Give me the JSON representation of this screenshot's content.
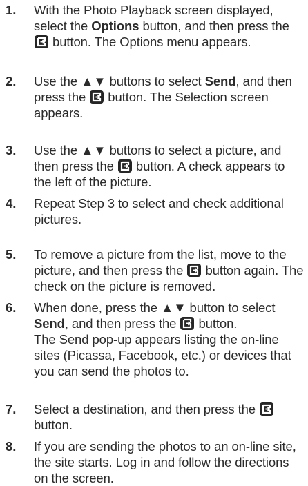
{
  "steps": [
    {
      "number": "1.",
      "segments": [
        {
          "t": "text",
          "v": "With the Photo Playback screen displayed, select the "
        },
        {
          "t": "bold",
          "v": "Options"
        },
        {
          "t": "text",
          "v": " button, and then press the "
        },
        {
          "t": "icon",
          "name": "enter-button-icon"
        },
        {
          "t": "text",
          "v": " button. The Options menu appears."
        }
      ]
    },
    {
      "number": "2.",
      "segments": [
        {
          "t": "text",
          "v": "Use the ▲▼ buttons to select "
        },
        {
          "t": "bold",
          "v": "Send"
        },
        {
          "t": "text",
          "v": ", and then press the "
        },
        {
          "t": "icon",
          "name": "enter-button-icon"
        },
        {
          "t": "text",
          "v": " button. The Selection screen appears."
        }
      ]
    },
    {
      "number": "3.",
      "segments": [
        {
          "t": "text",
          "v": "Use the ▲▼ buttons to select a picture, and then press the "
        },
        {
          "t": "icon",
          "name": "enter-button-icon"
        },
        {
          "t": "text",
          "v": " button. A check appears to the left of the picture."
        }
      ]
    },
    {
      "number": "4.",
      "segments": [
        {
          "t": "text",
          "v": "Repeat Step 3 to select and check additional pictures."
        }
      ]
    },
    {
      "number": "5.",
      "segments": [
        {
          "t": "text",
          "v": "To remove a picture from the list, move to the picture, and then press the "
        },
        {
          "t": "icon",
          "name": "enter-button-icon"
        },
        {
          "t": "text",
          "v": " button again. The check on the picture is removed."
        }
      ]
    },
    {
      "number": "6.",
      "segments": [
        {
          "t": "text",
          "v": "When done, press the ▲▼ button to select "
        },
        {
          "t": "bold",
          "v": "Send"
        },
        {
          "t": "text",
          "v": ", and then press the "
        },
        {
          "t": "icon",
          "name": "enter-button-icon"
        },
        {
          "t": "text",
          "v": " button."
        },
        {
          "t": "br"
        },
        {
          "t": "text",
          "v": "The Send pop-up appears listing the on-line sites (Picassa, Facebook, etc.) or devices that you can send the photos to."
        }
      ]
    },
    {
      "number": "7.",
      "segments": [
        {
          "t": "text",
          "v": "Select a destination, and then press the "
        },
        {
          "t": "icon",
          "name": "enter-button-icon"
        },
        {
          "t": "text",
          "v": " button."
        }
      ]
    },
    {
      "number": "8.",
      "segments": [
        {
          "t": "text",
          "v": "If you are sending the photos to an on-line site, the site starts. Log in and follow the directions on the screen."
        }
      ]
    }
  ]
}
